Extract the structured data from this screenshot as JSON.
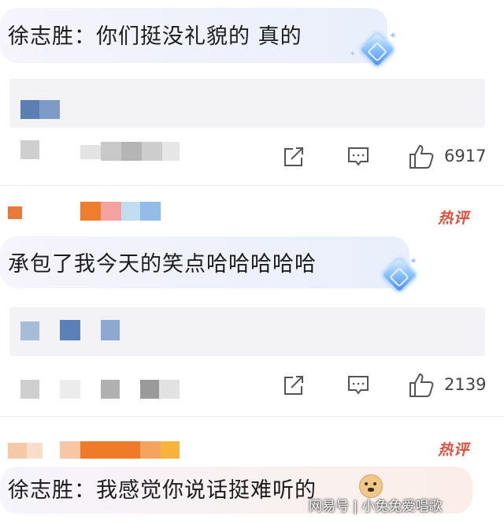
{
  "comments": [
    {
      "text": "徐志胜：你们挺没礼貌的 真的",
      "share_count": "",
      "msg_count": "",
      "like_count": "6917"
    },
    {
      "text": "承包了我今天的笑点哈哈哈哈哈",
      "like_count": "2139",
      "badge": "热评"
    },
    {
      "text": "徐志胜：我感觉你说话挺难听的",
      "badge": "热评"
    }
  ],
  "icons": {
    "share": "share-icon",
    "comment": "comment-icon",
    "like": "thumbs-up-icon",
    "emoji": "doge-emoji-icon",
    "gem": "diamond-gem-icon"
  },
  "watermark": "网易号 | 小兔兔爱唱歌",
  "colors": {
    "badge_red": "#e0503c",
    "bubble": "#eef1fb",
    "reply_bg": "#f3f3f5"
  }
}
